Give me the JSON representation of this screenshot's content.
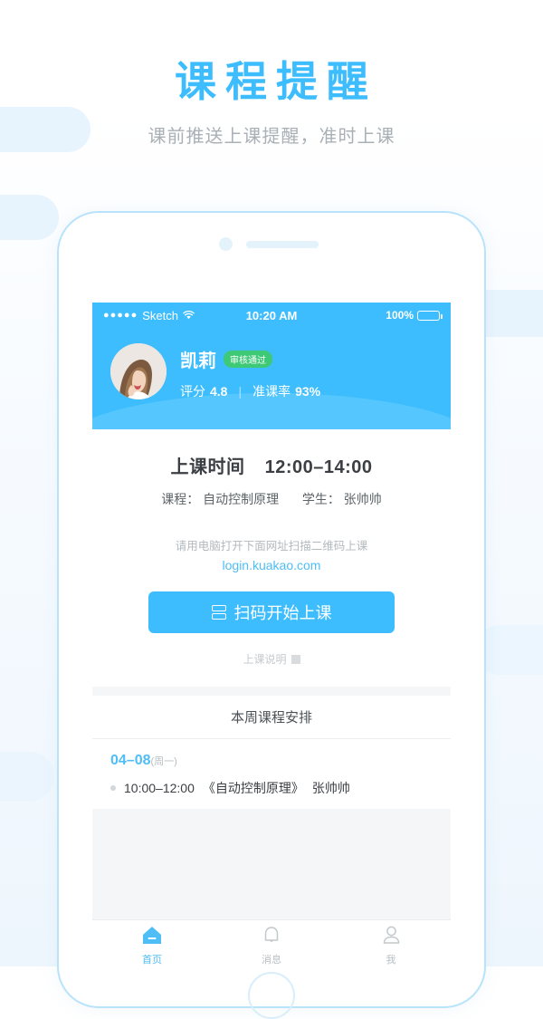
{
  "page": {
    "title": "课程提醒",
    "subtitle": "课前推送上课提醒，准时上课"
  },
  "colors": {
    "accent": "#3dbdfd",
    "badge_green": "#3ec977",
    "subtitle_gray": "#a9b0b6",
    "bg_decoration": "#e8f4fd"
  },
  "status_bar": {
    "signal_dots": "●●●●●",
    "carrier": "Sketch",
    "wifi_icon": "wifi-icon",
    "time": "10:20 AM",
    "battery_percent": "100%"
  },
  "profile": {
    "avatar_name": "avatar",
    "name": "凯莉",
    "badge": "审核通过",
    "rating_label": "评分",
    "rating_value": "4.8",
    "divider": "|",
    "attendance_label": "准课率",
    "attendance_value": "93%"
  },
  "class_card": {
    "time_label": "上课时间",
    "time_value": "12:00–14:00",
    "course_label": "课程：",
    "course_value": "自动控制原理",
    "student_label": "学生：",
    "student_value": "张帅帅",
    "hint": "请用电脑打开下面网址扫描二维码上课",
    "link": "login.kuakao.com",
    "button_label": "扫码开始上课",
    "button_icon": "scan-icon",
    "explain_label": "上课说明"
  },
  "schedule": {
    "header": "本周课程安排",
    "date": "04–08",
    "weekday": "(周一)",
    "items": [
      {
        "time": "10:00–12:00",
        "course": "《自动控制原理》",
        "student": "张帅帅"
      }
    ]
  },
  "tabbar": {
    "items": [
      {
        "label": "首页",
        "icon": "home-icon",
        "active": true
      },
      {
        "label": "消息",
        "icon": "bell-icon",
        "active": false
      },
      {
        "label": "我",
        "icon": "person-icon",
        "active": false
      }
    ]
  }
}
